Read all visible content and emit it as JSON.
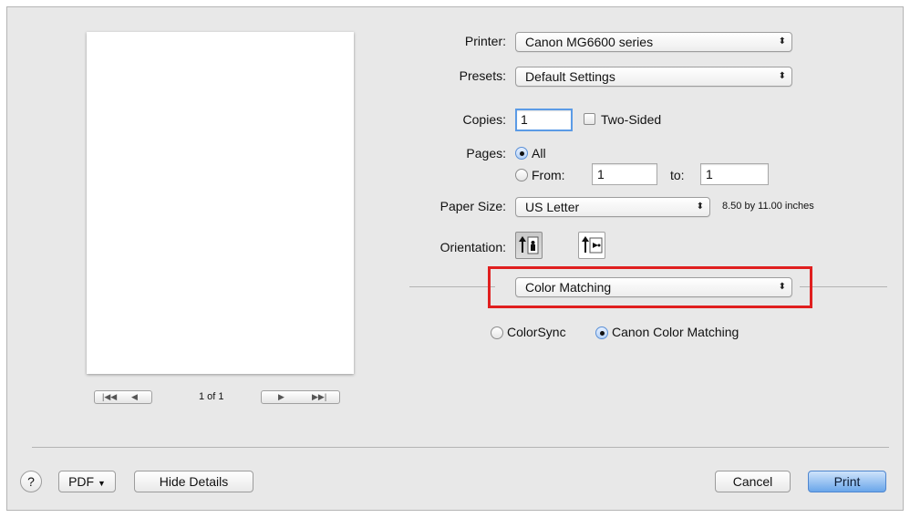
{
  "dialog": {
    "printer": {
      "label": "Printer:",
      "value": "Canon MG6600 series"
    },
    "presets": {
      "label": "Presets:",
      "value": "Default Settings"
    },
    "copies": {
      "label": "Copies:",
      "value": "1",
      "two_sided_label": "Two-Sided",
      "two_sided_checked": false
    },
    "pages": {
      "label": "Pages:",
      "all_label": "All",
      "all_selected": true,
      "from_label": "From:",
      "from_value": "1",
      "to_label": "to:",
      "to_value": "1"
    },
    "paper_size": {
      "label": "Paper Size:",
      "value": "US Letter",
      "dimensions": "8.50 by 11.00 inches"
    },
    "orientation": {
      "label": "Orientation:",
      "options": [
        "portrait",
        "landscape"
      ],
      "selected": "portrait"
    },
    "section_popup": {
      "value": "Color Matching"
    },
    "color_matching": {
      "options": [
        {
          "label": "ColorSync",
          "selected": false
        },
        {
          "label": "Canon Color Matching",
          "selected": true
        }
      ]
    },
    "preview": {
      "page_indicator": "1 of 1"
    },
    "footer": {
      "help_label": "?",
      "pdf_label": "PDF",
      "hide_details_label": "Hide Details",
      "cancel_label": "Cancel",
      "print_label": "Print"
    },
    "colors": {
      "highlight": "#e01f1f",
      "default_button": "#6aa6ea"
    }
  }
}
